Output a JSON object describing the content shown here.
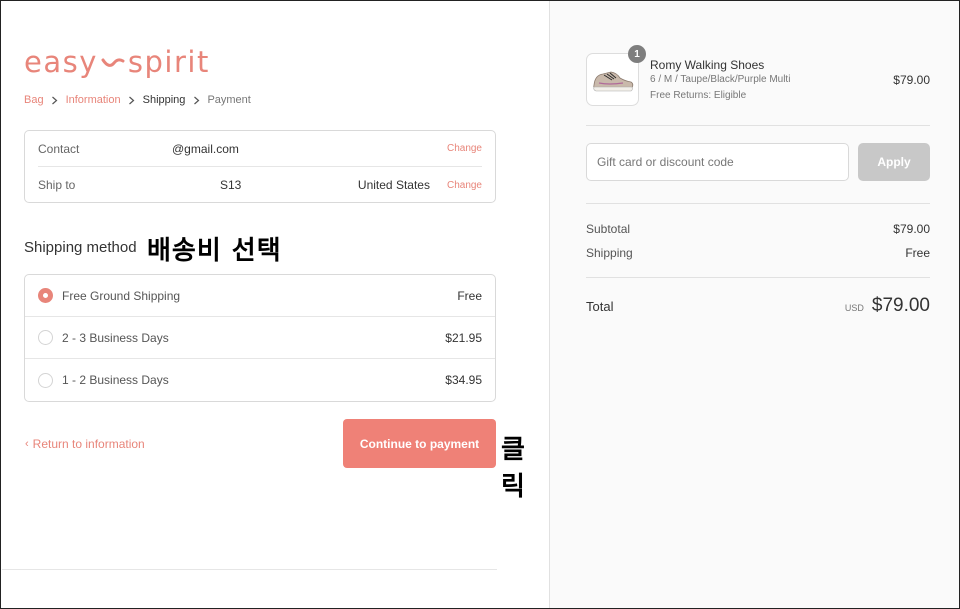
{
  "logo": {
    "left": "easy",
    "right": "spirit"
  },
  "breadcrumb": {
    "items": [
      "Bag",
      "Information",
      "Shipping",
      "Payment"
    ]
  },
  "contact": {
    "label": "Contact",
    "value": "@gmail.com",
    "change": "Change"
  },
  "ship_to": {
    "label": "Ship to",
    "value": "S13",
    "country": "United States",
    "change": "Change"
  },
  "shipping_method": {
    "title": "Shipping method",
    "options": [
      {
        "label": "Free Ground Shipping",
        "price": "Free",
        "selected": true
      },
      {
        "label": "2 - 3 Business Days",
        "price": "$21.95",
        "selected": false
      },
      {
        "label": "1 - 2 Business Days",
        "price": "$34.95",
        "selected": false
      }
    ]
  },
  "annotations": {
    "select_shipping": "배송비 선택",
    "click": "클릭"
  },
  "actions": {
    "return_label": "Return to information",
    "continue_label": "Continue to payment"
  },
  "cart": {
    "quantity": "1",
    "product_name": "Romy Walking Shoes",
    "product_variant": "6 / M / Taupe/Black/Purple Multi",
    "product_returns": "Free Returns: Eligible",
    "product_price": "$79.00"
  },
  "discount": {
    "placeholder": "Gift card or discount code",
    "apply_label": "Apply"
  },
  "summary": {
    "subtotal_label": "Subtotal",
    "subtotal_value": "$79.00",
    "shipping_label": "Shipping",
    "shipping_value": "Free",
    "total_label": "Total",
    "total_currency": "USD",
    "total_value": "$79.00"
  },
  "colors": {
    "accent": "#e8857a",
    "button": "#ef8177",
    "apply_disabled": "#c8c8c8"
  },
  "icons": [
    "chevron-right-icon",
    "chevron-left-icon",
    "radio-icon",
    "shoe-image"
  ]
}
